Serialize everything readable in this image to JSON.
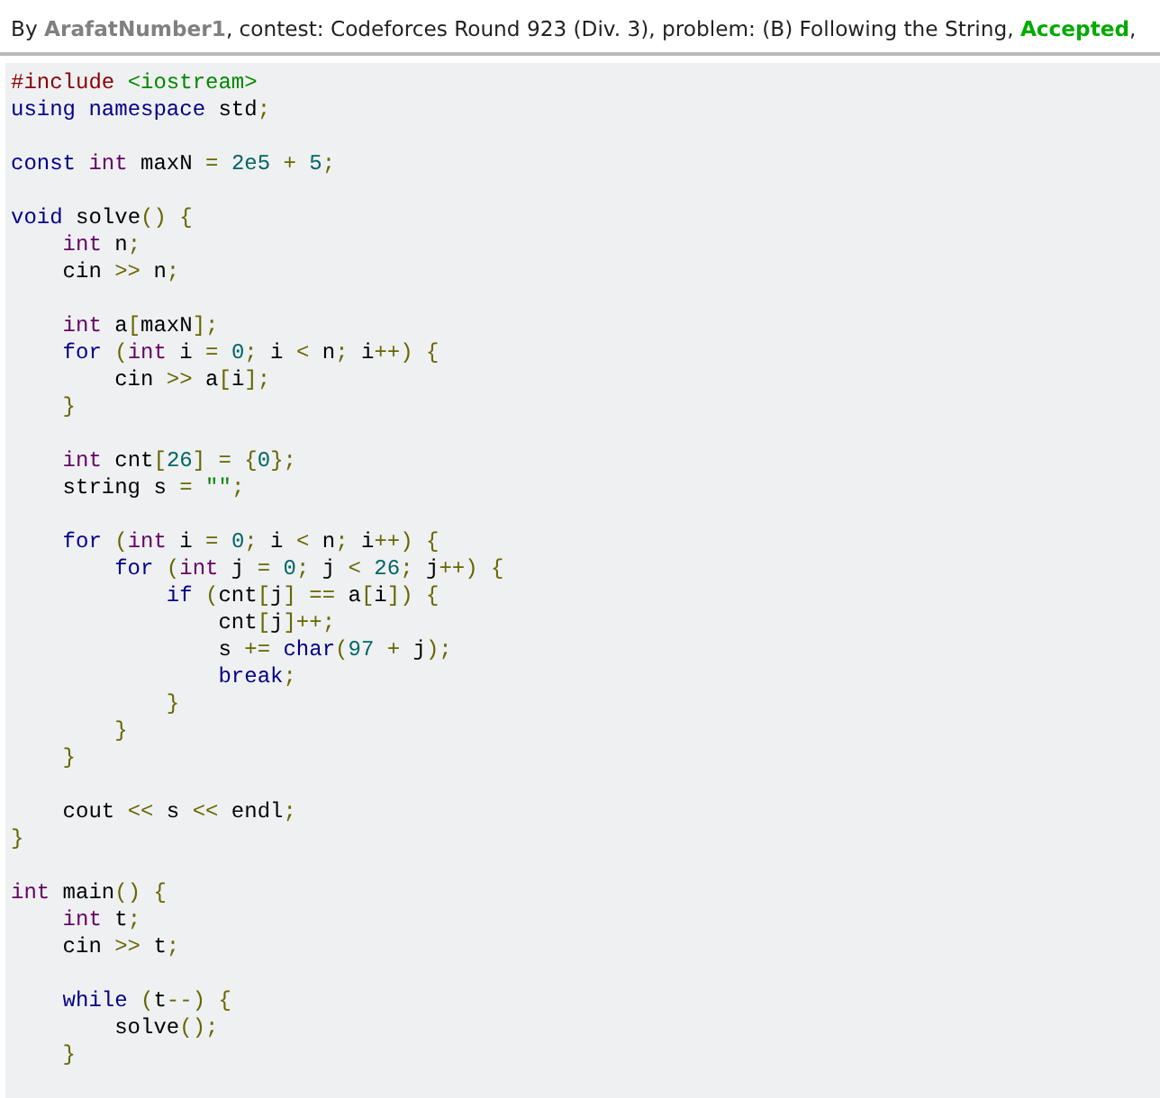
{
  "header": {
    "prefix": "By ",
    "author": "ArafatNumber1",
    "details": ", contest: Codeforces Round 923 (Div. 3), problem: (B) Following the String, ",
    "verdict": "Accepted",
    "tail": ","
  },
  "code_lines": [
    {
      "kind": "code",
      "tokens": [
        {
          "kind": "com",
          "text": "#include "
        },
        {
          "kind": "str",
          "text": "<iostream>"
        }
      ]
    },
    {
      "kind": "code",
      "tokens": [
        {
          "kind": "kwd",
          "text": "using"
        },
        {
          "kind": "kwd",
          "text": " namespace"
        },
        {
          "kind": "pln",
          "text": " std"
        },
        {
          "kind": "pun",
          "text": ";"
        }
      ]
    },
    {
      "kind": "blank"
    },
    {
      "kind": "code",
      "tokens": [
        {
          "kind": "kwd",
          "text": "const"
        },
        {
          "kind": "typ",
          "text": " int"
        },
        {
          "kind": "pln",
          "text": " maxN "
        },
        {
          "kind": "pun",
          "text": "="
        },
        {
          "kind": "lit",
          "text": " 2e5"
        },
        {
          "kind": "pun",
          "text": " +"
        },
        {
          "kind": "lit",
          "text": " 5"
        },
        {
          "kind": "pun",
          "text": ";"
        }
      ]
    },
    {
      "kind": "blank"
    },
    {
      "kind": "code",
      "tokens": [
        {
          "kind": "kwd",
          "text": "void"
        },
        {
          "kind": "pln",
          "text": " solve"
        },
        {
          "kind": "pun",
          "text": "() {"
        }
      ]
    },
    {
      "kind": "code",
      "tokens": [
        {
          "kind": "typ",
          "text": "    int"
        },
        {
          "kind": "pln",
          "text": " n"
        },
        {
          "kind": "pun",
          "text": ";"
        }
      ]
    },
    {
      "kind": "code",
      "tokens": [
        {
          "kind": "pln",
          "text": "    cin "
        },
        {
          "kind": "pun",
          "text": ">>"
        },
        {
          "kind": "pln",
          "text": " n"
        },
        {
          "kind": "pun",
          "text": ";"
        }
      ]
    },
    {
      "kind": "blank"
    },
    {
      "kind": "code",
      "tokens": [
        {
          "kind": "typ",
          "text": "    int"
        },
        {
          "kind": "pln",
          "text": " a"
        },
        {
          "kind": "pun",
          "text": "["
        },
        {
          "kind": "pln",
          "text": "maxN"
        },
        {
          "kind": "pun",
          "text": "];"
        }
      ]
    },
    {
      "kind": "code",
      "tokens": [
        {
          "kind": "kwd",
          "text": "    for"
        },
        {
          "kind": "pun",
          "text": " ("
        },
        {
          "kind": "typ",
          "text": "int"
        },
        {
          "kind": "pln",
          "text": " i "
        },
        {
          "kind": "pun",
          "text": "="
        },
        {
          "kind": "lit",
          "text": " 0"
        },
        {
          "kind": "pun",
          "text": ";"
        },
        {
          "kind": "pln",
          "text": " i "
        },
        {
          "kind": "pun",
          "text": "<"
        },
        {
          "kind": "pln",
          "text": " n"
        },
        {
          "kind": "pun",
          "text": ";"
        },
        {
          "kind": "pln",
          "text": " i"
        },
        {
          "kind": "pun",
          "text": "++) {"
        }
      ]
    },
    {
      "kind": "code",
      "tokens": [
        {
          "kind": "pln",
          "text": "        cin "
        },
        {
          "kind": "pun",
          "text": ">>"
        },
        {
          "kind": "pln",
          "text": " a"
        },
        {
          "kind": "pun",
          "text": "["
        },
        {
          "kind": "pln",
          "text": "i"
        },
        {
          "kind": "pun",
          "text": "];"
        }
      ]
    },
    {
      "kind": "code",
      "tokens": [
        {
          "kind": "pun",
          "text": "    }"
        }
      ]
    },
    {
      "kind": "blank"
    },
    {
      "kind": "code",
      "tokens": [
        {
          "kind": "typ",
          "text": "    int"
        },
        {
          "kind": "pln",
          "text": " cnt"
        },
        {
          "kind": "pun",
          "text": "["
        },
        {
          "kind": "lit",
          "text": "26"
        },
        {
          "kind": "pun",
          "text": "] = {"
        },
        {
          "kind": "lit",
          "text": "0"
        },
        {
          "kind": "pun",
          "text": "};"
        }
      ]
    },
    {
      "kind": "code",
      "tokens": [
        {
          "kind": "pln",
          "text": "    string s "
        },
        {
          "kind": "pun",
          "text": "="
        },
        {
          "kind": "str",
          "text": " \"\""
        },
        {
          "kind": "pun",
          "text": ";"
        }
      ]
    },
    {
      "kind": "blank"
    },
    {
      "kind": "code",
      "tokens": [
        {
          "kind": "kwd",
          "text": "    for"
        },
        {
          "kind": "pun",
          "text": " ("
        },
        {
          "kind": "typ",
          "text": "int"
        },
        {
          "kind": "pln",
          "text": " i "
        },
        {
          "kind": "pun",
          "text": "="
        },
        {
          "kind": "lit",
          "text": " 0"
        },
        {
          "kind": "pun",
          "text": ";"
        },
        {
          "kind": "pln",
          "text": " i "
        },
        {
          "kind": "pun",
          "text": "<"
        },
        {
          "kind": "pln",
          "text": " n"
        },
        {
          "kind": "pun",
          "text": ";"
        },
        {
          "kind": "pln",
          "text": " i"
        },
        {
          "kind": "pun",
          "text": "++) {"
        }
      ]
    },
    {
      "kind": "code",
      "tokens": [
        {
          "kind": "kwd",
          "text": "        for"
        },
        {
          "kind": "pun",
          "text": " ("
        },
        {
          "kind": "typ",
          "text": "int"
        },
        {
          "kind": "pln",
          "text": " j "
        },
        {
          "kind": "pun",
          "text": "="
        },
        {
          "kind": "lit",
          "text": " 0"
        },
        {
          "kind": "pun",
          "text": ";"
        },
        {
          "kind": "pln",
          "text": " j "
        },
        {
          "kind": "pun",
          "text": "<"
        },
        {
          "kind": "lit",
          "text": " 26"
        },
        {
          "kind": "pun",
          "text": ";"
        },
        {
          "kind": "pln",
          "text": " j"
        },
        {
          "kind": "pun",
          "text": "++) {"
        }
      ]
    },
    {
      "kind": "code",
      "tokens": [
        {
          "kind": "kwd",
          "text": "            if"
        },
        {
          "kind": "pun",
          "text": " ("
        },
        {
          "kind": "pln",
          "text": "cnt"
        },
        {
          "kind": "pun",
          "text": "["
        },
        {
          "kind": "pln",
          "text": "j"
        },
        {
          "kind": "pun",
          "text": "] =="
        },
        {
          "kind": "pln",
          "text": " a"
        },
        {
          "kind": "pun",
          "text": "["
        },
        {
          "kind": "pln",
          "text": "i"
        },
        {
          "kind": "pun",
          "text": "]) {"
        }
      ]
    },
    {
      "kind": "code",
      "tokens": [
        {
          "kind": "pln",
          "text": "                cnt"
        },
        {
          "kind": "pun",
          "text": "["
        },
        {
          "kind": "pln",
          "text": "j"
        },
        {
          "kind": "pun",
          "text": "]++;"
        }
      ]
    },
    {
      "kind": "code",
      "tokens": [
        {
          "kind": "pln",
          "text": "                s "
        },
        {
          "kind": "pun",
          "text": "+="
        },
        {
          "kind": "kwd",
          "text": " char"
        },
        {
          "kind": "pun",
          "text": "("
        },
        {
          "kind": "lit",
          "text": "97"
        },
        {
          "kind": "pun",
          "text": " +"
        },
        {
          "kind": "pln",
          "text": " j"
        },
        {
          "kind": "pun",
          "text": ");"
        }
      ]
    },
    {
      "kind": "code",
      "tokens": [
        {
          "kind": "kwd",
          "text": "                break"
        },
        {
          "kind": "pun",
          "text": ";"
        }
      ]
    },
    {
      "kind": "code",
      "tokens": [
        {
          "kind": "pun",
          "text": "            }"
        }
      ]
    },
    {
      "kind": "code",
      "tokens": [
        {
          "kind": "pun",
          "text": "        }"
        }
      ]
    },
    {
      "kind": "code",
      "tokens": [
        {
          "kind": "pun",
          "text": "    }"
        }
      ]
    },
    {
      "kind": "blank"
    },
    {
      "kind": "code",
      "tokens": [
        {
          "kind": "pln",
          "text": "    cout "
        },
        {
          "kind": "pun",
          "text": "<<"
        },
        {
          "kind": "pln",
          "text": " s "
        },
        {
          "kind": "pun",
          "text": "<<"
        },
        {
          "kind": "pln",
          "text": " endl"
        },
        {
          "kind": "pun",
          "text": ";"
        }
      ]
    },
    {
      "kind": "code",
      "tokens": [
        {
          "kind": "pun",
          "text": "}"
        }
      ]
    },
    {
      "kind": "blank"
    },
    {
      "kind": "code",
      "tokens": [
        {
          "kind": "typ",
          "text": "int"
        },
        {
          "kind": "pln",
          "text": " main"
        },
        {
          "kind": "pun",
          "text": "() {"
        }
      ]
    },
    {
      "kind": "code",
      "tokens": [
        {
          "kind": "typ",
          "text": "    int"
        },
        {
          "kind": "pln",
          "text": " t"
        },
        {
          "kind": "pun",
          "text": ";"
        }
      ]
    },
    {
      "kind": "code",
      "tokens": [
        {
          "kind": "pln",
          "text": "    cin "
        },
        {
          "kind": "pun",
          "text": ">>"
        },
        {
          "kind": "pln",
          "text": " t"
        },
        {
          "kind": "pun",
          "text": ";"
        }
      ]
    },
    {
      "kind": "blank"
    },
    {
      "kind": "code",
      "tokens": [
        {
          "kind": "kwd",
          "text": "    while"
        },
        {
          "kind": "pun",
          "text": " ("
        },
        {
          "kind": "pln",
          "text": "t"
        },
        {
          "kind": "pun",
          "text": "--) {"
        }
      ]
    },
    {
      "kind": "code",
      "tokens": [
        {
          "kind": "pln",
          "text": "        solve"
        },
        {
          "kind": "pun",
          "text": "();"
        }
      ]
    },
    {
      "kind": "code",
      "tokens": [
        {
          "kind": "pun",
          "text": "    }"
        }
      ]
    },
    {
      "kind": "blank"
    }
  ]
}
